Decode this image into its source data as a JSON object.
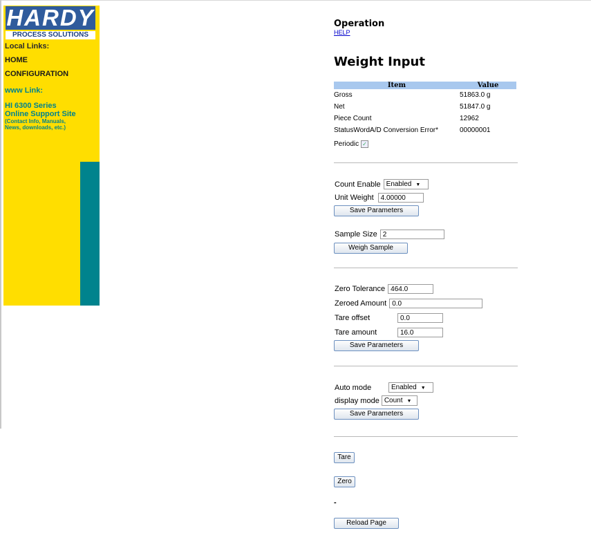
{
  "sidebar": {
    "logo_word": "HARDY",
    "logo_sub": "PROCESS SOLUTIONS",
    "local_links_heading": "Local Links:",
    "home": "HOME",
    "configuration": "CONFIGURATION",
    "www_link": "www Link:",
    "support_line1": "HI 6300 Series",
    "support_line2": "Online Support Site",
    "support_line3": "(Contact Info, Manuals,",
    "support_line4": "News, downloads, etc.)"
  },
  "header": {
    "title": "Operation",
    "help": "HELP"
  },
  "page_title": "Weight Input",
  "table": {
    "headers": [
      "Item",
      "Value"
    ],
    "rows": [
      {
        "item": "Gross",
        "value": "51863.0 g"
      },
      {
        "item": "Net",
        "value": "51847.0 g"
      },
      {
        "item": "Piece Count",
        "value": "12962"
      },
      {
        "item": "StatusWordA/D Conversion Error*",
        "value": "00000001"
      }
    ]
  },
  "periodic": {
    "label": "Periodic",
    "checked": true
  },
  "count_section": {
    "count_enable_label": "Count Enable",
    "count_enable_value": "Enabled",
    "unit_weight_label": "Unit Weight",
    "unit_weight_value": "4.00000",
    "save_label": "Save Parameters",
    "sample_size_label": "Sample Size",
    "sample_size_value": "2",
    "weigh_sample_label": "Weigh Sample"
  },
  "zero_section": {
    "zero_tolerance_label": "Zero Tolerance",
    "zero_tolerance_value": "464.0",
    "zeroed_amount_label": "Zeroed Amount",
    "zeroed_amount_value": "0.0",
    "tare_offset_label": "Tare offset",
    "tare_offset_value": "0.0",
    "tare_amount_label": "Tare amount",
    "tare_amount_value": "16.0",
    "save_label": "Save Parameters"
  },
  "mode_section": {
    "auto_mode_label": "Auto mode",
    "auto_mode_value": "Enabled",
    "display_mode_label": "display mode",
    "display_mode_value": "Count",
    "save_label": "Save Parameters"
  },
  "actions": {
    "tare": "Tare",
    "zero": "Zero",
    "dash": "-",
    "reload": "Reload Page"
  }
}
